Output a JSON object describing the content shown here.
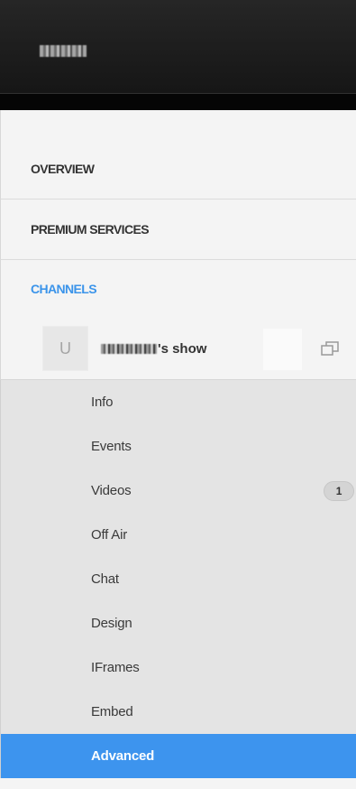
{
  "header": {
    "username": "redacted"
  },
  "nav": {
    "sections": [
      {
        "label": "OVERVIEW"
      },
      {
        "label": "PREMIUM SERVICES"
      },
      {
        "label": "CHANNELS"
      }
    ]
  },
  "channel": {
    "avatar_letter": "U",
    "name_suffix": "'s show"
  },
  "subnav": {
    "items": [
      {
        "label": "Info"
      },
      {
        "label": "Events"
      },
      {
        "label": "Videos",
        "badge": "1"
      },
      {
        "label": "Off Air"
      },
      {
        "label": "Chat"
      },
      {
        "label": "Design"
      },
      {
        "label": "IFrames"
      },
      {
        "label": "Embed"
      },
      {
        "label": "Advanced"
      }
    ]
  },
  "colors": {
    "accent": "#3b94ea",
    "active_bg": "#3d94ee",
    "topbar": "#1c1c1c",
    "subnav_bg": "#e4e4e4"
  },
  "icons": {
    "popout": "popout-icon"
  }
}
